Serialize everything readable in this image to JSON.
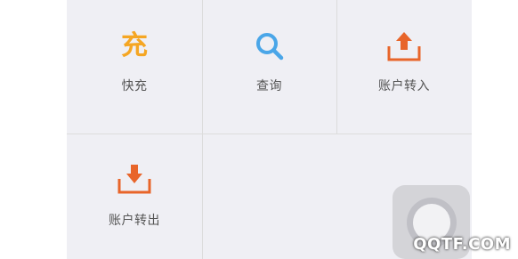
{
  "grid": {
    "items": [
      {
        "label": "快充",
        "icon": "quick-charge-icon",
        "icon_char": "充",
        "color": "#f5a623"
      },
      {
        "label": "查询",
        "icon": "search-icon",
        "color": "#4aa6e8"
      },
      {
        "label": "账户转入",
        "icon": "transfer-in-icon",
        "color": "#e8652a"
      },
      {
        "label": "账户转出",
        "icon": "transfer-out-icon",
        "color": "#e8652a"
      }
    ]
  },
  "watermark": "QQTF.COM",
  "colors": {
    "panel_bg": "#efeff4",
    "divider": "#dcdcdc",
    "label": "#555555"
  }
}
